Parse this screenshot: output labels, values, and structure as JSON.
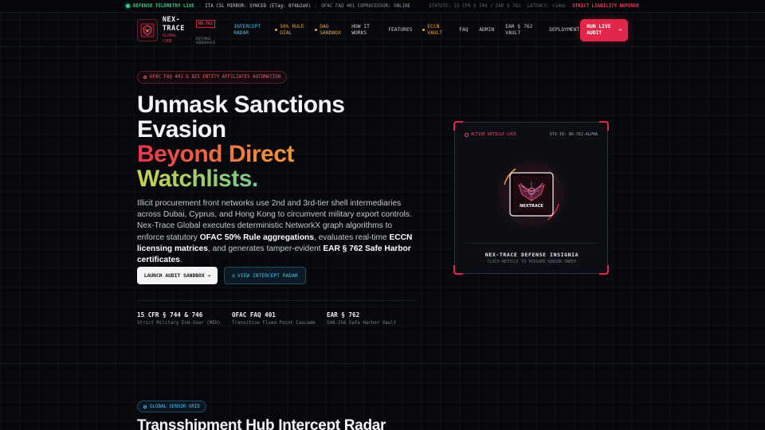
{
  "telemetry": {
    "live_label": "DEFENSE TELEMETRY LIVE",
    "mirror": "ITA CSL MIRROR: SYNCED (ETag: 8f4b2a9)",
    "coprocessor": "OFAC FAQ 401 COPROCESSOR: ONLINE",
    "statute": "STATUTE: 15 CFR § 744 / EAR § 762",
    "latency": "LATENCY: <14ms",
    "strict": "STRICT LIABILITY DEFENSE"
  },
  "nav": {
    "brand_title": "NEX-TRACE",
    "brand_sub": "GLOBAL CORE",
    "badge": "NX-762",
    "badge_sub": "DEFENSE AEROSPACE",
    "links": [
      {
        "label": "INTERCEPT RADAR"
      },
      {
        "label": "50% RULE DIAL"
      },
      {
        "label": "DAG SANDBOX"
      },
      {
        "label": "HOW IT WORKS"
      },
      {
        "label": "FEATURES"
      },
      {
        "label": "ECCN VAULT"
      },
      {
        "label": "FAQ"
      },
      {
        "label": "ADMIN"
      },
      {
        "label": "EAR § 762 VAULT"
      },
      {
        "label": "DEPLOYMENT"
      }
    ],
    "cta": "RUN LIVE AUDIT",
    "cta_arrow": "→"
  },
  "hero": {
    "chip": "OFAC FAQ 401 & BIS ENTITY AFFILIATES AUTOMATION",
    "title_l1": "Unmask Sanctions",
    "title_l2": "Evasion",
    "title_l3": "Beyond Direct",
    "title_l4": "Watchlists.",
    "para_1": "Illicit procurement front networks use 2nd and 3rd-tier shell intermediaries across Dubai, Cyprus, and Hong Kong to circumvent military export controls. Nex-Trace Global executes deterministic NetworkX graph algorithms to enforce statutory ",
    "para_b1": "OFAC 50% Rule aggregations",
    "para_2": ", evaluates real-time ",
    "para_b2": "ECCN licensing matrices",
    "para_3": ", and generates tamper-evident ",
    "para_b3": "EAR § 762 Safe Harbor certificates",
    "para_4": ".",
    "btn_primary": "LAUNCH AUDIT SANDBOX →",
    "btn_secondary": "VIEW INTERCEPT RADAR",
    "btn_secondary_icon": "◎",
    "stats": [
      {
        "value": "15 CFR § 744 & 746",
        "label": "Strict Military End-User (MEU)"
      },
      {
        "value": "OFAC FAQ 401",
        "label": "Transitive Fixed-Point Cascade"
      },
      {
        "value": "EAR § 762",
        "label": "SHA-256 Safe Harbor Vault"
      }
    ]
  },
  "insignia": {
    "status": "ACTIVE RETICLE LOCK",
    "sys_id": "SYS-ID: NX-762-ALPHA",
    "emblem_text": "NEXTRACE",
    "name": "NEX-TRACE DEFENSE INSIGNIA",
    "hint": "CLICK RETICLE TO TRIGGER SENSOR SWEEP"
  },
  "section2": {
    "chip": "GLOBAL SENSOR GRID",
    "title": "Transshipment Hub Intercept Radar"
  },
  "colors": {
    "accent_red": "#e1284a",
    "accent_cyan": "#46bff0",
    "accent_amber": "#f2a634",
    "live_green": "#35d08a"
  }
}
